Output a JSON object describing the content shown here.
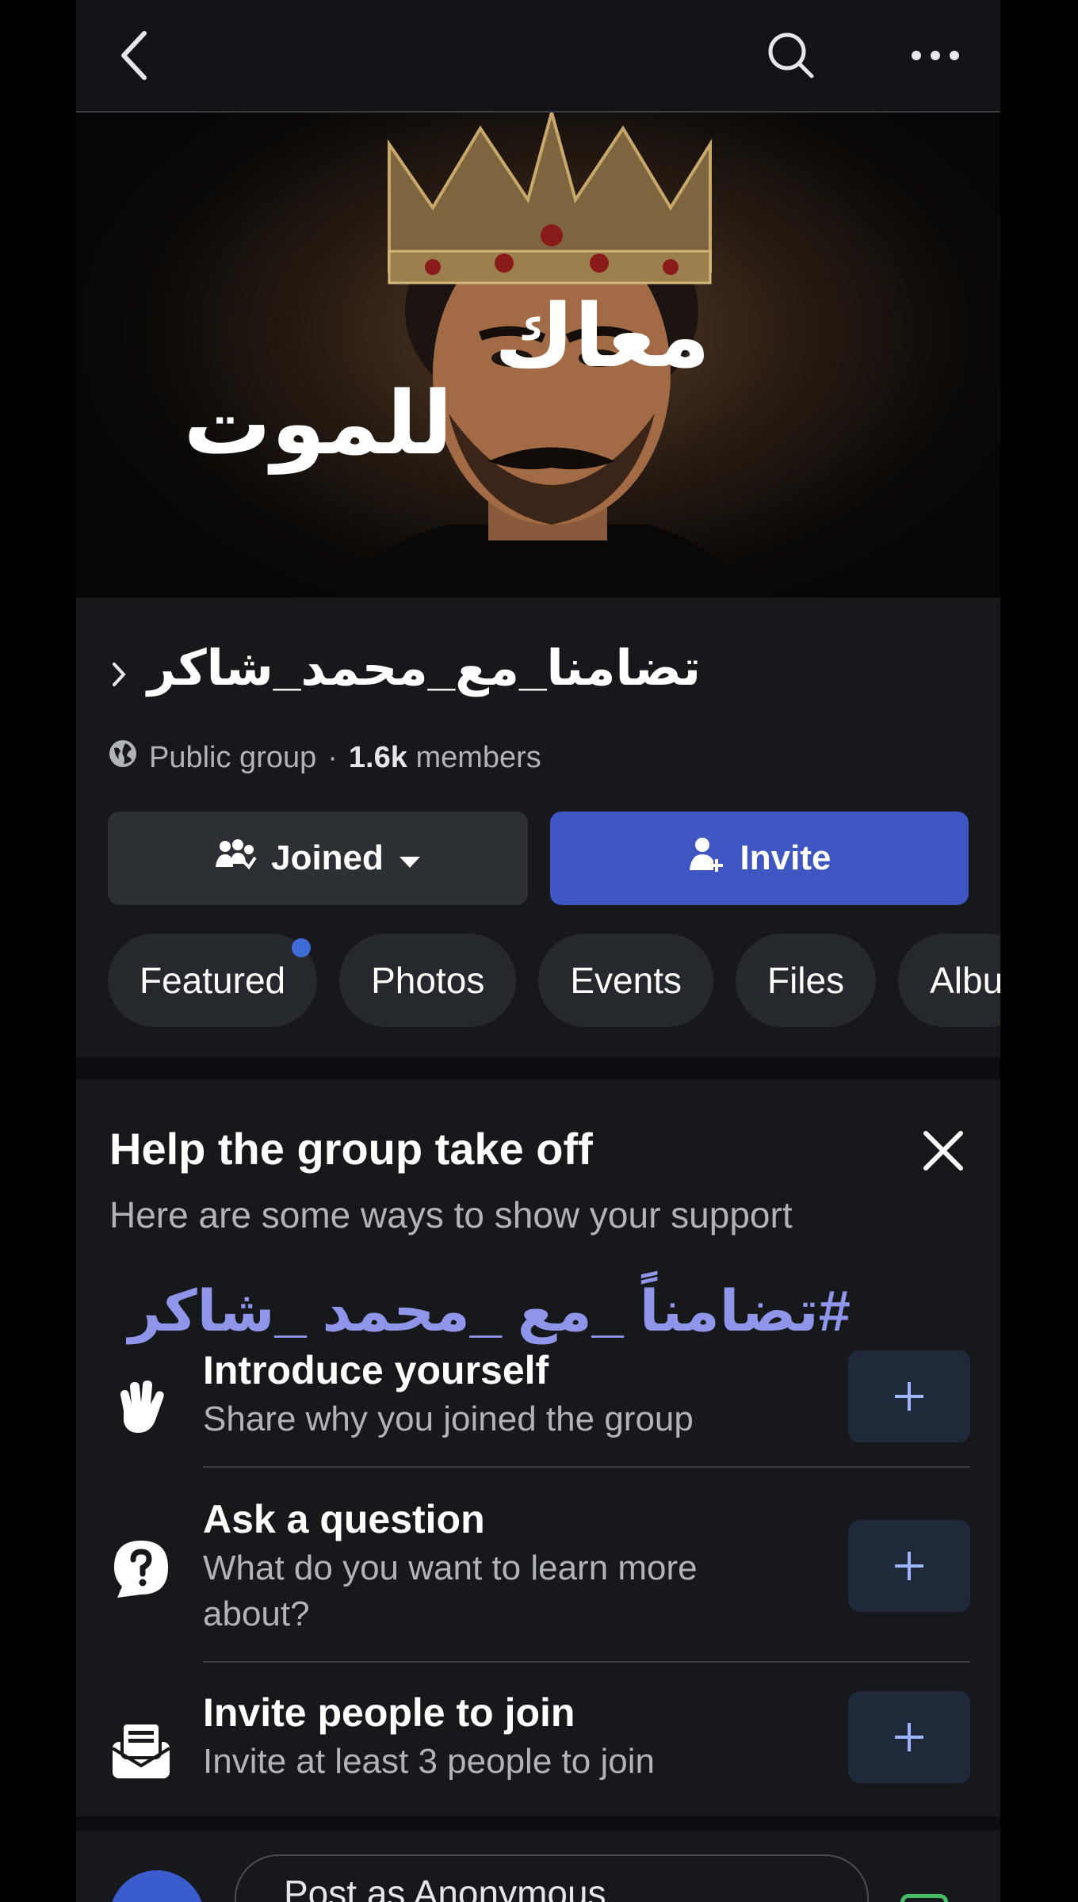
{
  "cover": {
    "text_line1": "معاك",
    "text_line2": "للموت"
  },
  "group": {
    "name": "تضامنا_مع_محمد_شاكر",
    "privacy": "Public group",
    "separator": "·",
    "members_count": "1.6k",
    "members_label": "members"
  },
  "actions": {
    "joined_label": "Joined",
    "invite_label": "Invite"
  },
  "tabs": [
    {
      "label": "Featured"
    },
    {
      "label": "Photos"
    },
    {
      "label": "Events"
    },
    {
      "label": "Files"
    },
    {
      "label": "Albu"
    }
  ],
  "help_card": {
    "title": "Help the group take off",
    "subtitle": "Here are some ways to show your support",
    "hashtag_overlay": "#تضامناً _مع _محمد _شاكر",
    "items": [
      {
        "title": "Introduce yourself",
        "subtitle": "Share why you joined the group",
        "icon": "wave-hand-icon"
      },
      {
        "title": "Ask a question",
        "subtitle": "What do you want to learn more about?",
        "icon": "question-bubble-icon"
      },
      {
        "title": "Invite people to join",
        "subtitle": "Invite at least 3 people to join",
        "icon": "invite-envelope-icon"
      }
    ]
  },
  "composer": {
    "placeholder": "Post as Anonymous"
  },
  "colors": {
    "accent": "#3e55c2",
    "background": "#0b0d10",
    "card": "#16181c",
    "hashtag": "#8f96ea"
  }
}
